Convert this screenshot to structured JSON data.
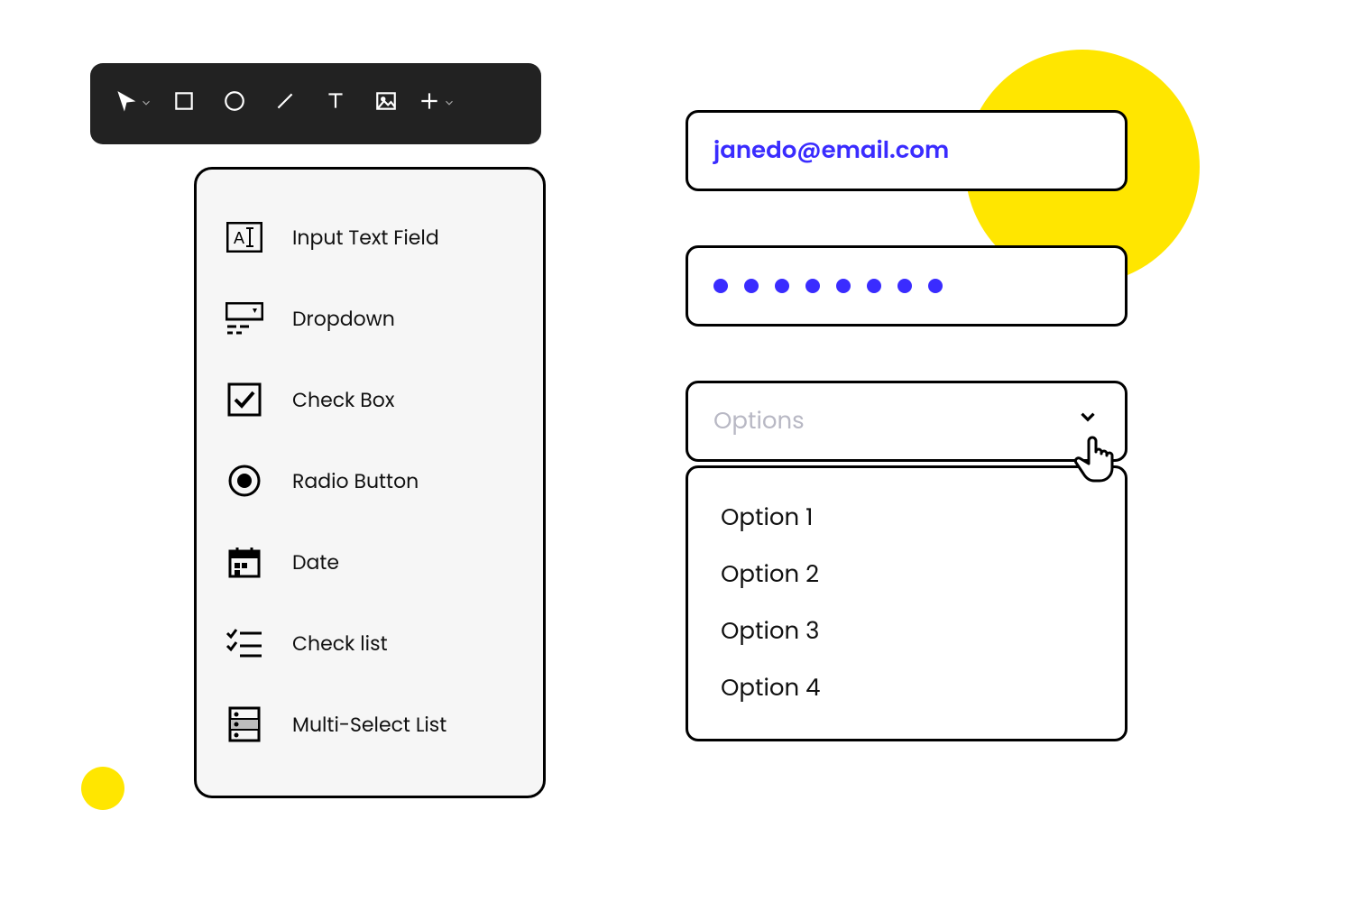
{
  "toolbar": {
    "tools": [
      {
        "name": "pointer",
        "has_dropdown": true
      },
      {
        "name": "rectangle",
        "has_dropdown": false
      },
      {
        "name": "circle",
        "has_dropdown": false
      },
      {
        "name": "line",
        "has_dropdown": false
      },
      {
        "name": "text",
        "has_dropdown": false
      },
      {
        "name": "image",
        "has_dropdown": false
      },
      {
        "name": "plus",
        "has_dropdown": true
      }
    ]
  },
  "palette": {
    "items": [
      {
        "icon": "input-text",
        "label": "Input Text Field"
      },
      {
        "icon": "dropdown",
        "label": "Dropdown"
      },
      {
        "icon": "checkbox",
        "label": "Check Box"
      },
      {
        "icon": "radio",
        "label": "Radio Button"
      },
      {
        "icon": "date",
        "label": "Date"
      },
      {
        "icon": "checklist",
        "label": "Check list"
      },
      {
        "icon": "multiselect",
        "label": "Multi-Select List"
      }
    ]
  },
  "form": {
    "email_value": "janedo@email.com",
    "password_dot_count": 8,
    "select": {
      "placeholder": "Options",
      "options": [
        "Option 1",
        "Option 2",
        "Option 3",
        "Option 4"
      ]
    }
  },
  "colors": {
    "accent_blue": "#3a2cff",
    "highlight_yellow": "#ffe600"
  }
}
